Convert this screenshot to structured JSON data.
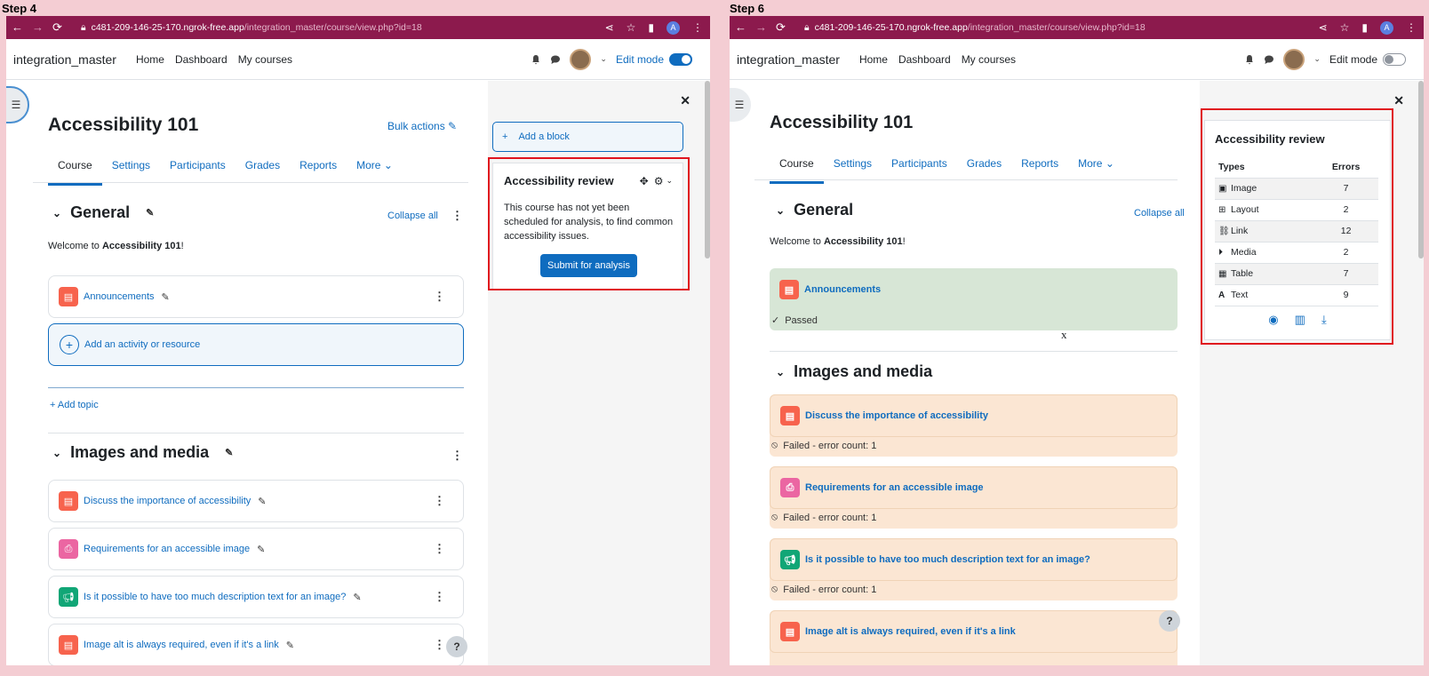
{
  "steps": [
    "Step 4",
    "Step 6"
  ],
  "browser": {
    "url_host": "c481-209-146-25-170.ngrok-free.app",
    "url_path": "/integration_master/course/view.php?id=18",
    "profile_initial": "A"
  },
  "navbar": {
    "site_name": "integration_master",
    "links": [
      "Home",
      "Dashboard",
      "My courses"
    ],
    "edit_mode_label": "Edit mode"
  },
  "course": {
    "title": "Accessibility 101",
    "bulk_actions": "Bulk actions",
    "tabs": [
      "Course",
      "Settings",
      "Participants",
      "Grades",
      "Reports",
      "More"
    ],
    "welcome_prefix": "Welcome to ",
    "welcome_course": "Accessibility 101",
    "welcome_suffix": "!"
  },
  "step4": {
    "section_general": "General",
    "collapse_all": "Collapse all",
    "announcements": "Announcements",
    "add_activity": "Add an activity or resource",
    "add_topic": "Add topic",
    "section_images": "Images and media",
    "activities": [
      "Discuss the importance of accessibility",
      "Requirements for an accessible image",
      "Is it possible to have too much description text for an image?",
      "Image alt is always required, even if it's a link"
    ],
    "drawer": {
      "add_block": "Add a block",
      "block_title": "Accessibility review",
      "block_text": "This course has not yet been scheduled for analysis, to find common accessibility issues.",
      "submit": "Submit for analysis"
    }
  },
  "step6": {
    "section_general": "General",
    "collapse_all": "Collapse all",
    "announcements": "Announcements",
    "passed": "Passed",
    "stray_mark": "x",
    "section_images": "Images and media",
    "activities": [
      {
        "name": "Discuss the importance of accessibility",
        "status": "Failed - error count: 1"
      },
      {
        "name": "Requirements for an accessible image",
        "status": "Failed - error count: 1"
      },
      {
        "name": "Is it possible to have too much description text for an image?",
        "status": "Failed - error count: 1"
      },
      {
        "name": "Image alt is always required, even if it's a link",
        "status": ""
      }
    ],
    "review": {
      "title": "Accessibility review",
      "col_types": "Types",
      "col_errors": "Errors",
      "rows": [
        {
          "type": "Image",
          "errors": "7",
          "icon": "image-icon"
        },
        {
          "type": "Layout",
          "errors": "2",
          "icon": "layout-icon"
        },
        {
          "type": "Link",
          "errors": "12",
          "icon": "link-icon"
        },
        {
          "type": "Media",
          "errors": "2",
          "icon": "media-icon"
        },
        {
          "type": "Table",
          "errors": "7",
          "icon": "table-icon"
        },
        {
          "type": "Text",
          "errors": "9",
          "icon": "text-icon"
        }
      ]
    }
  },
  "help": "?",
  "colors": {
    "brand": "#0f6cbf",
    "chrome": "#8c1a4d",
    "highlight": "#e0141e",
    "passed_bg": "#d7e6d6",
    "failed_bg": "#fbe6d3"
  }
}
